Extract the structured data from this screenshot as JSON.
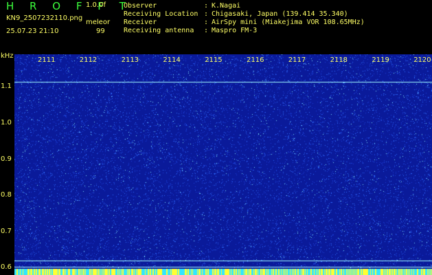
{
  "header": {
    "brand": "H R O F F T",
    "version": "1.0.0f",
    "filename": "KN9_2507232110.png",
    "code": "meleor",
    "timestamp": "25.07.23 21:10",
    "number": "99",
    "info": [
      {
        "label": "Observer",
        "value": "K.Nagai"
      },
      {
        "label": "Receiving Location",
        "value": "Chigasaki, Japan (139.414 35.340)"
      },
      {
        "label": "Receiver",
        "value": "AirSpy mini (Miakejima VOR 108.65MHz)"
      },
      {
        "label": "Receiving antenna",
        "value": "Maspro FM-3"
      }
    ]
  },
  "chart_data": {
    "type": "heatmap",
    "ylabel": "kHz",
    "yticks": [
      "1.1",
      "1.0",
      "0.9",
      "0.8",
      "0.7",
      "0.6"
    ],
    "xticks": [
      "2111",
      "2112",
      "2113",
      "2114",
      "2115",
      "2116",
      "2117",
      "2118",
      "2119",
      "2120"
    ],
    "ylim": [
      0.58,
      1.19
    ],
    "colors": {
      "background": "#0a1a9a",
      "noise": "#2f6bff",
      "bright": "#7fe7ff",
      "line": "#9ff7ff",
      "bottom_strip_a": "#ffff33",
      "bottom_strip_b": "#33e6ff"
    }
  }
}
